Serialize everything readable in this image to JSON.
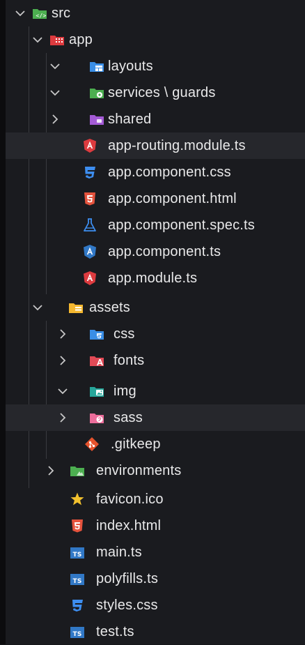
{
  "tree": {
    "src": "src",
    "app": "app",
    "layouts": "layouts",
    "services_guards": "services \\ guards",
    "shared": "shared",
    "app_routing": "app-routing.module.ts",
    "app_component_css": "app.component.css",
    "app_component_html": "app.component.html",
    "app_component_spec": "app.component.spec.ts",
    "app_component_ts": "app.component.ts",
    "app_module": "app.module.ts",
    "assets": "assets",
    "css": "css",
    "fonts": "fonts",
    "img": "img",
    "sass": "sass",
    "gitkeep": ".gitkeep",
    "environments": "environments",
    "favicon": "favicon.ico",
    "index_html": "index.html",
    "main_ts": "main.ts",
    "polyfills_ts": "polyfills.ts",
    "styles_css": "styles.css",
    "test_ts": "test.ts"
  },
  "icon_names": {
    "src": "src-folder-icon",
    "app": "angular-app-folder-icon",
    "layouts": "layout-folder-icon",
    "services": "services-folder-icon",
    "shared": "shared-folder-icon",
    "routing": "angular-routing-icon",
    "css": "css-file-icon",
    "html": "html-file-icon",
    "spec": "test-spec-icon",
    "component": "angular-component-icon",
    "module": "angular-module-icon",
    "assets": "assets-folder-icon",
    "css_folder": "css-folder-icon",
    "fonts_folder": "fonts-folder-icon",
    "img_folder": "images-folder-icon",
    "sass_folder": "sass-folder-icon",
    "git": "git-icon",
    "env_folder": "environment-folder-icon",
    "favicon": "star-icon",
    "ts": "typescript-file-icon"
  },
  "colors": {
    "background": "#1a1b1f",
    "highlight": "#26272c",
    "angular_red": "#dd3b3f",
    "css_blue": "#3d8ef0",
    "html_orange": "#e5533d",
    "ts_blue": "#3178c6",
    "folder_green": "#4caf50",
    "folder_blue": "#3a8ee6",
    "folder_purple": "#a45bd6",
    "folder_yellow": "#f5b830",
    "git_orange": "#e5532d",
    "star_yellow": "#f2c12e"
  }
}
